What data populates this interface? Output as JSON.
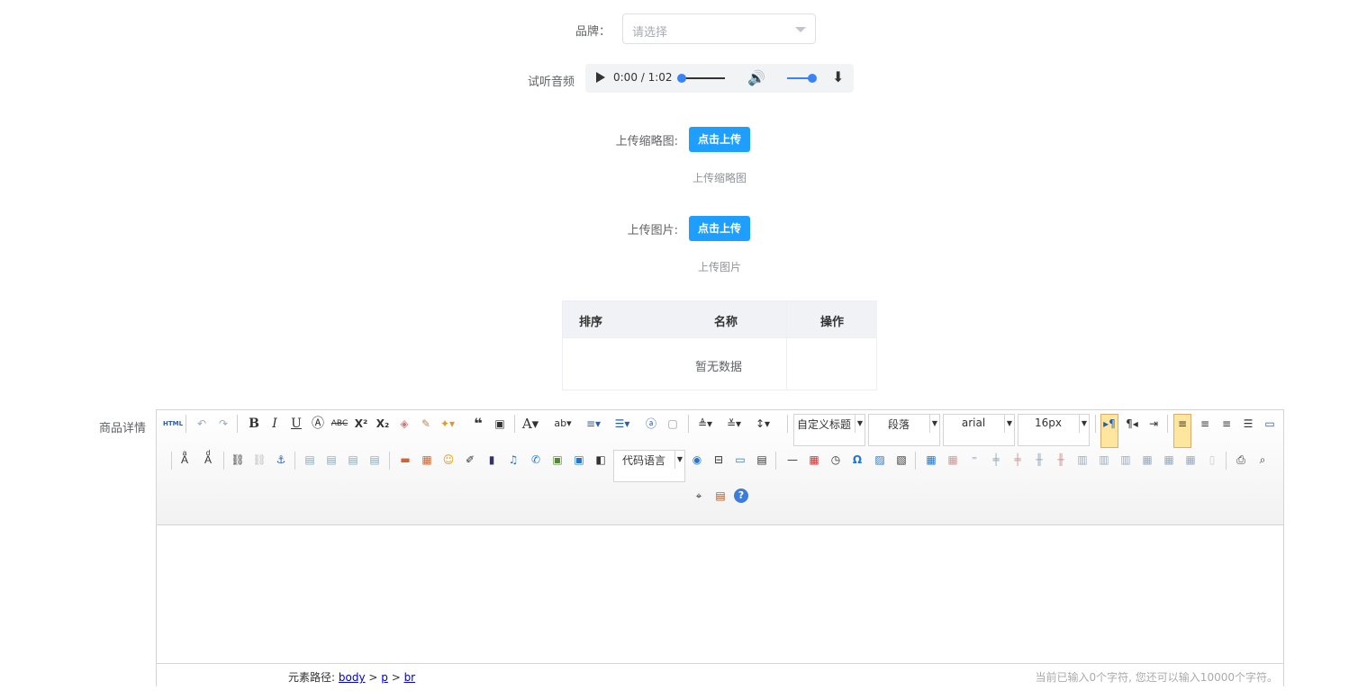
{
  "brand": {
    "label": "品牌：",
    "placeholder": "请选择"
  },
  "audio": {
    "label": "试听音频",
    "time": "0:00 / 1:02",
    "progress": 0,
    "volume": 1
  },
  "thumb": {
    "label": "上传缩略图:",
    "button": "点击上传",
    "tip": "上传缩略图"
  },
  "image": {
    "label": "上传图片:",
    "button": "点击上传",
    "tip": "上传图片"
  },
  "table": {
    "headers": [
      "排序",
      "名称",
      "操作"
    ],
    "empty": "暂无数据"
  },
  "editor": {
    "label": "商品详情",
    "combos": {
      "heading": "自定义标题",
      "paragraph": "段落",
      "font": "arial",
      "size": "16px",
      "code": "代码语言"
    },
    "path_label": "元素路径:",
    "path": [
      "body",
      "p",
      "br"
    ],
    "count_text": "当前已输入0个字符, 您还可以输入10000个字符。",
    "icons": [
      "html-icon",
      "undo-icon",
      "redo-icon",
      "bold-icon",
      "italic-icon",
      "underline-icon",
      "font-border-icon",
      "strikethrough-icon",
      "superscript-icon",
      "subscript-icon",
      "eraser-icon",
      "format-brush-icon",
      "auto-format-icon",
      "quote-icon",
      "paste-plain-icon",
      "font-color-icon",
      "background-color-icon",
      "ordered-list-icon",
      "unordered-list-icon",
      "select-all-icon",
      "clear-doc-icon",
      "row-spacing-top-icon",
      "row-spacing-bottom-icon",
      "line-height-icon",
      "ltr-icon",
      "rtl-icon",
      "indent-icon",
      "align-left-icon",
      "align-center-icon",
      "align-right-icon",
      "align-justify-icon",
      "fullscreen-icon"
    ]
  }
}
